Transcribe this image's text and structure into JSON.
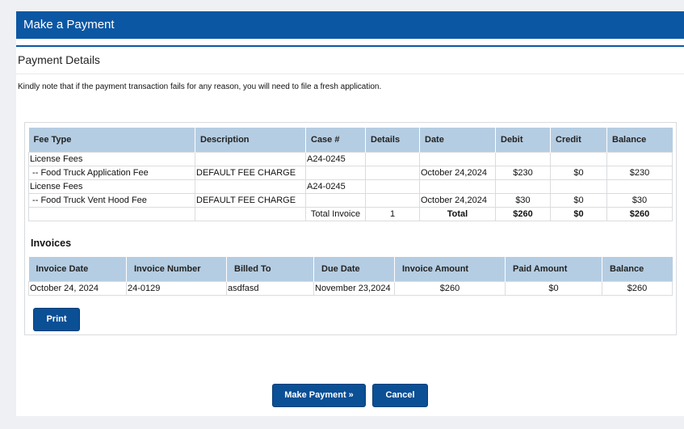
{
  "header": {
    "title": "Make a Payment"
  },
  "section": {
    "title": "Payment Details"
  },
  "notice": "Kindly note that if the payment transaction fails for any reason, you will need to file a fresh application.",
  "fees": {
    "columns": [
      "Fee Type",
      "Description",
      "Case #",
      "Details",
      "Date",
      "Debit",
      "Credit",
      "Balance"
    ],
    "rows": [
      {
        "fee_type": "License Fees",
        "description": "",
        "case": "A24-0245",
        "details": "",
        "date": "",
        "debit": "",
        "credit": "",
        "balance": ""
      },
      {
        "fee_type": " -- Food Truck Application Fee",
        "description": "DEFAULT FEE CHARGE",
        "case": "",
        "details": "",
        "date": "October 24,2024",
        "debit": "$230",
        "credit": "$0",
        "balance": "$230"
      },
      {
        "fee_type": "License Fees",
        "description": "",
        "case": "A24-0245",
        "details": "",
        "date": "",
        "debit": "",
        "credit": "",
        "balance": ""
      },
      {
        "fee_type": " -- Food Truck Vent Hood Fee",
        "description": "DEFAULT FEE CHARGE",
        "case": "",
        "details": "",
        "date": "October 24,2024",
        "debit": "$30",
        "credit": "$0",
        "balance": "$30"
      }
    ],
    "total": {
      "label": "Total Invoice",
      "count": "1",
      "total_label": "Total",
      "debit": "$260",
      "credit": "$0",
      "balance": "$260"
    }
  },
  "invoices": {
    "title": "Invoices",
    "columns": [
      "Invoice Date",
      "Invoice Number",
      "Billed To",
      "Due Date",
      "Invoice Amount",
      "Paid Amount",
      "Balance"
    ],
    "rows": [
      {
        "invoice_date": "October 24, 2024",
        "invoice_number": "24-0129",
        "billed_to": "asdfasd",
        "due_date": "November 23,2024",
        "amount": "$260",
        "paid": "$0",
        "balance": "$260"
      }
    ]
  },
  "buttons": {
    "print": "Print",
    "make_payment": "Make Payment »",
    "cancel": "Cancel"
  },
  "colors": {
    "brand": "#0b57a4",
    "button": "#0b4f95",
    "table_header": "#b5cde2"
  }
}
